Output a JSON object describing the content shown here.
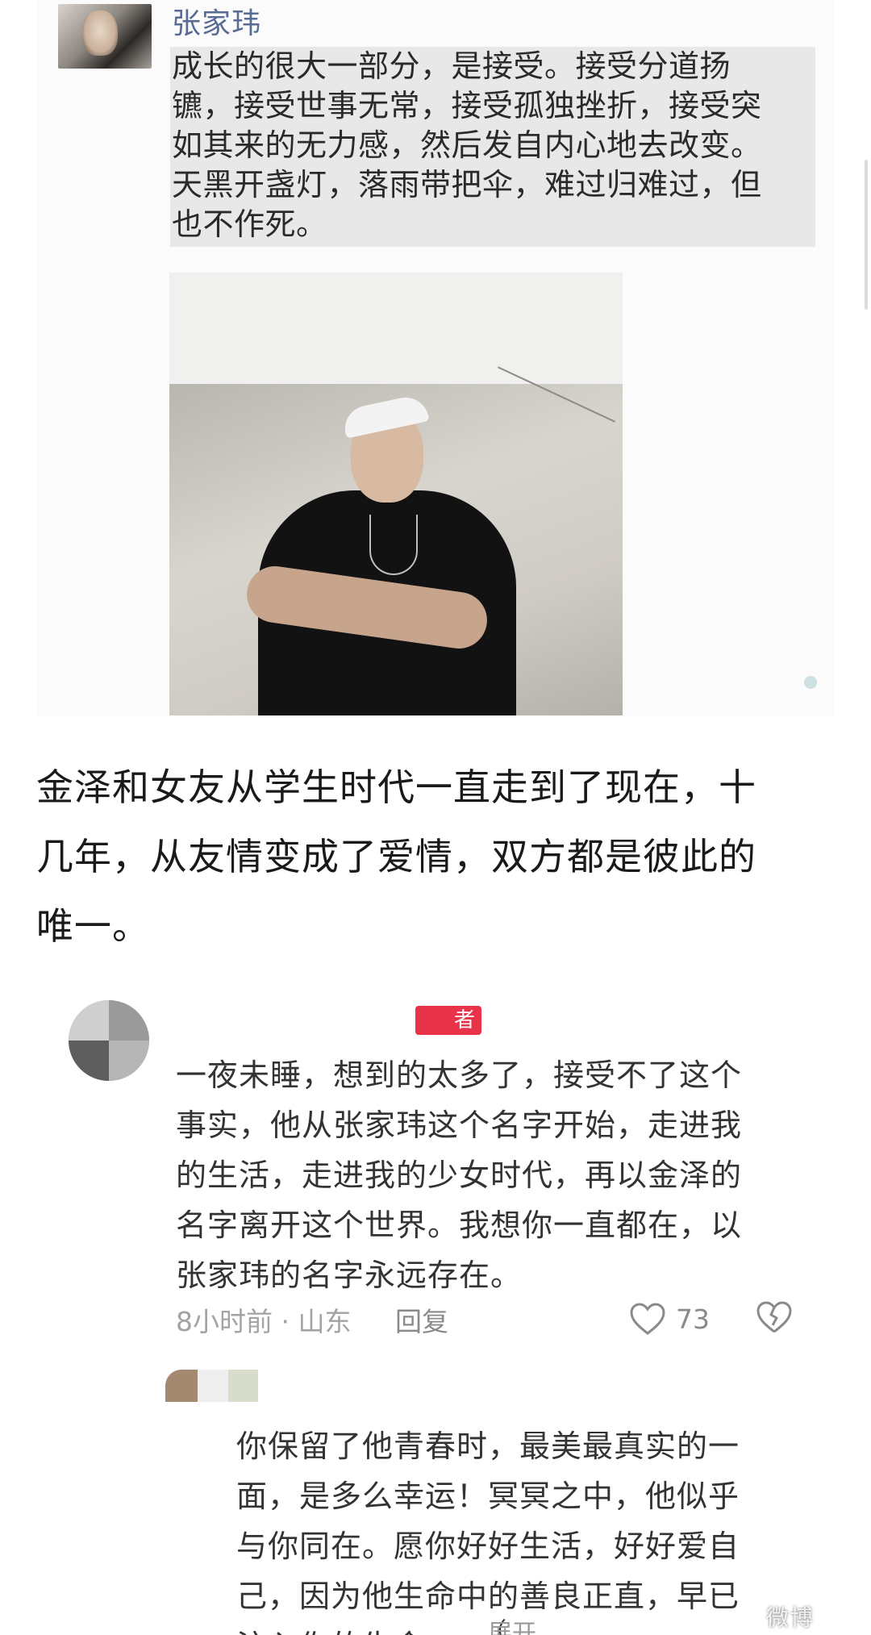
{
  "post": {
    "author": "张家玮",
    "text_lines": [
      "成长的很大一部分，是接受。接受分道扬",
      "镳，接受世事无常，接受孤独挫折，接受突",
      "如其来的无力感，然后发自内心地去改变。",
      "天黑开盏灯，落雨带把伞，难过归难过，但",
      "也不作死。"
    ]
  },
  "caption": {
    "lines": [
      "金泽和女友从学生时代一直走到了现在，十",
      "几年，从友情变成了爱情，双方都是彼此的",
      "唯一。"
    ]
  },
  "comment": {
    "badge": "者",
    "text_lines": [
      "一夜未睡，想到的太多了，接受不了这个",
      "事实，他从张家玮这个名字开始，走进我",
      "的生活，走进我的少女时代，再以金泽的",
      "名字离开这个世界。我想你一直都在，以",
      "张家玮的名字永远存在。"
    ],
    "meta": "8小时前 · 山东",
    "reply_label": "回复",
    "like_count": "73"
  },
  "reply": {
    "text_lines": [
      "你保留了他青春时，最美最真实的一",
      "面，是多么幸运！冥冥之中，他似乎",
      "与你同在。愿你好好生活，好好爱自",
      "己，因为他生命中的善良正直，早已",
      "注入你的生命"
    ],
    "bracket": "（",
    "expand_label": "展开"
  },
  "watermark": "微博"
}
